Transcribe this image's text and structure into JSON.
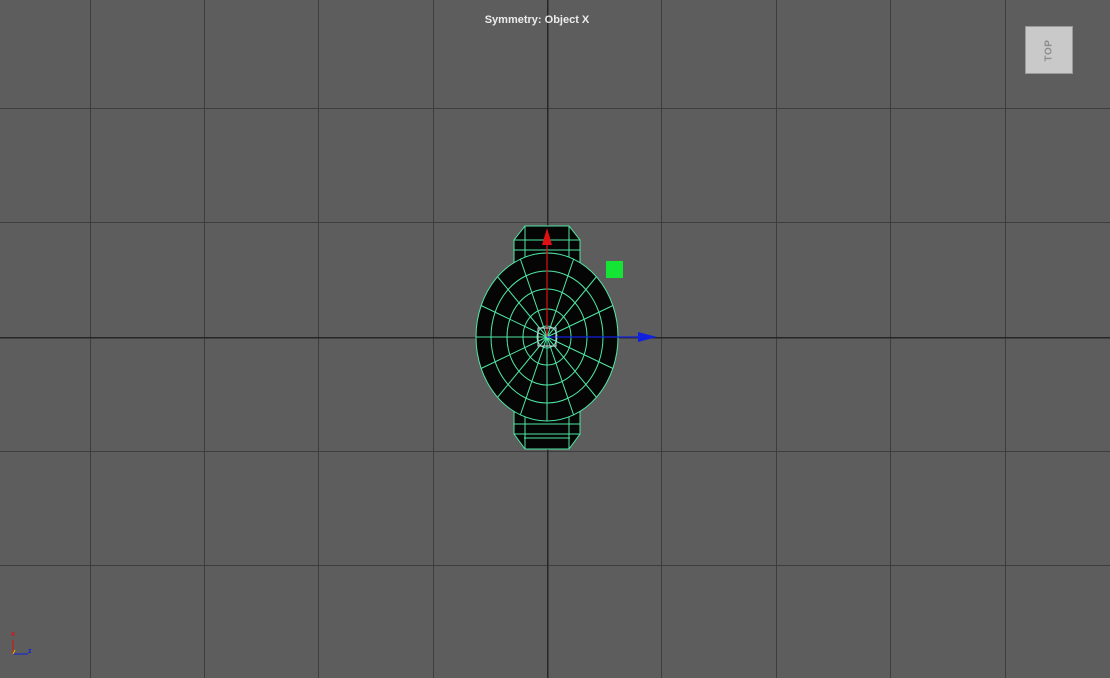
{
  "viewport": {
    "name": "Top orthographic viewport",
    "symmetry_label": "Symmetry: Object X",
    "view_cube_label": "TOP"
  },
  "axis_indicator": {
    "x_label": "x",
    "z_label": "z"
  },
  "colors": {
    "background": "#5d5d5d",
    "grid_line": "#3a3a3a",
    "grid_axis": "#262626",
    "wireframe": "#4fe8a4",
    "mesh_fill": "#050505",
    "x_axis": "#e01010",
    "z_axis": "#1020e0",
    "manipulator_handle": "#14e534"
  },
  "icons": {
    "move_x_arrow": "red-arrow-up-icon",
    "move_z_arrow": "blue-arrow-right-icon",
    "move_center": "square-handle-icon",
    "plane_handle": "green-square-icon"
  }
}
